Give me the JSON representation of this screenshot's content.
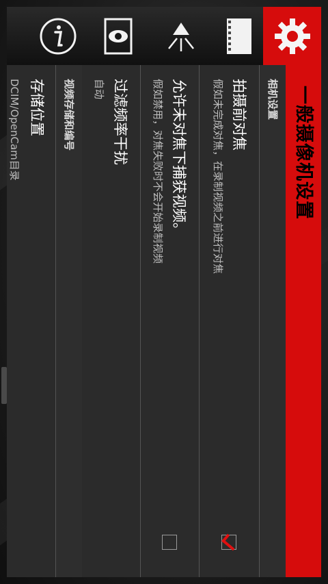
{
  "header": {
    "title": "一般摄像机设置"
  },
  "toolbar": {
    "icons": [
      {
        "name": "info-icon"
      },
      {
        "name": "eye-icon"
      },
      {
        "name": "light-icon"
      },
      {
        "name": "film-icon"
      },
      {
        "name": "settings-icon",
        "active": true
      }
    ],
    "accent_color": "#d60c0c"
  },
  "sections": {
    "camera": {
      "label": "相机设置",
      "rows": {
        "focus_before": {
          "title": "拍摄前对焦",
          "subtitle": "假如未完成对焦，在录制视频之前进行对焦",
          "checked": true
        },
        "allow_unfocused": {
          "title": "允许未对焦下捕获视频。",
          "subtitle": "假如禁用，对焦失败时不会开始录制视频",
          "checked": false
        },
        "flicker": {
          "title": "过滤频率干扰",
          "subtitle": "自动"
        }
      }
    },
    "storage": {
      "label": "视频存储和编号",
      "rows": {
        "location": {
          "title": "存储位置",
          "subtitle": "DCIM/OpenCam目录"
        }
      }
    }
  }
}
